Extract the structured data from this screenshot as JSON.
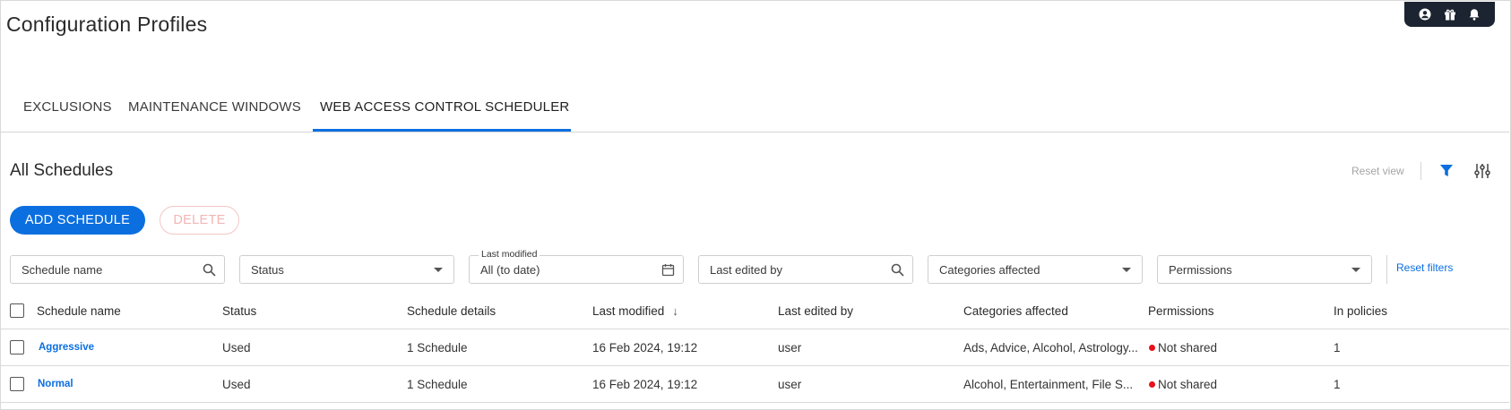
{
  "page": {
    "title": "Configuration Profiles"
  },
  "toolbar": {
    "icons": [
      "user-icon",
      "gift-icon",
      "bell-icon"
    ]
  },
  "tabs": [
    {
      "label": "EXCLUSIONS",
      "active": false
    },
    {
      "label": "MAINTENANCE WINDOWS",
      "active": false
    },
    {
      "label": "WEB ACCESS CONTROL SCHEDULER",
      "active": true
    }
  ],
  "section": {
    "title": "All Schedules",
    "reset_view": "Reset view"
  },
  "actions": {
    "add_label": "ADD SCHEDULE",
    "delete_label": "DELETE"
  },
  "filters": {
    "schedule_name": {
      "placeholder": "Schedule name"
    },
    "status": {
      "value": "Status"
    },
    "last_modified": {
      "label": "Last modified",
      "value": "All (to date)"
    },
    "last_edited_by": {
      "placeholder": "Last edited by"
    },
    "categories": {
      "value": "Categories affected"
    },
    "permissions": {
      "value": "Permissions"
    },
    "reset_label": "Reset filters"
  },
  "table": {
    "columns": [
      "Schedule name",
      "Status",
      "Schedule details",
      "Last modified",
      "Last edited by",
      "Categories affected",
      "Permissions",
      "In policies"
    ],
    "rows": [
      {
        "name": "Aggressive",
        "status": "Used",
        "details": "1 Schedule",
        "modified": "16 Feb 2024, 19:12",
        "editor": "user",
        "categories": "Ads, Advice, Alcohol, Astrology...",
        "permissions": "Not shared",
        "policies": "1"
      },
      {
        "name": "Normal",
        "status": "Used",
        "details": "1 Schedule",
        "modified": "16 Feb 2024, 19:12",
        "editor": "user",
        "categories": "Alcohol, Entertainment, File S...",
        "permissions": "Not shared",
        "policies": "1"
      }
    ]
  },
  "colors": {
    "accent": "#0b6fe0",
    "toolbar_bg": "#1b2430",
    "status_red": "#e8101a"
  }
}
